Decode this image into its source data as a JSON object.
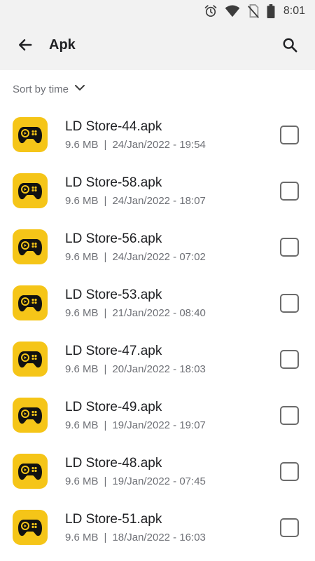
{
  "status_bar": {
    "time": "8:01",
    "icons": [
      "alarm-icon",
      "wifi-icon",
      "no-sim-icon",
      "battery-icon"
    ]
  },
  "app_bar": {
    "title": "Apk",
    "back_icon": "arrow-left-icon",
    "search_icon": "search-icon"
  },
  "sort": {
    "label": "Sort by time",
    "icon": "chevron-down-icon"
  },
  "files": [
    {
      "name": "LD Store-44.apk",
      "size": "9.6 MB",
      "date": "24/Jan/2022 - 19:54"
    },
    {
      "name": "LD Store-58.apk",
      "size": "9.6 MB",
      "date": "24/Jan/2022 - 18:07"
    },
    {
      "name": "LD Store-56.apk",
      "size": "9.6 MB",
      "date": "24/Jan/2022 - 07:02"
    },
    {
      "name": "LD Store-53.apk",
      "size": "9.6 MB",
      "date": "21/Jan/2022 - 08:40"
    },
    {
      "name": "LD Store-47.apk",
      "size": "9.6 MB",
      "date": "20/Jan/2022 - 18:03"
    },
    {
      "name": "LD Store-49.apk",
      "size": "9.6 MB",
      "date": "19/Jan/2022 - 19:07"
    },
    {
      "name": "LD Store-48.apk",
      "size": "9.6 MB",
      "date": "19/Jan/2022 - 07:45"
    },
    {
      "name": "LD Store-51.apk",
      "size": "9.6 MB",
      "date": "18/Jan/2022 - 16:03"
    }
  ],
  "meta_separator": "|",
  "colors": {
    "app_icon_bg": "#f5c518",
    "header_bg": "#f2f2f2",
    "secondary_text": "#6e7076"
  }
}
